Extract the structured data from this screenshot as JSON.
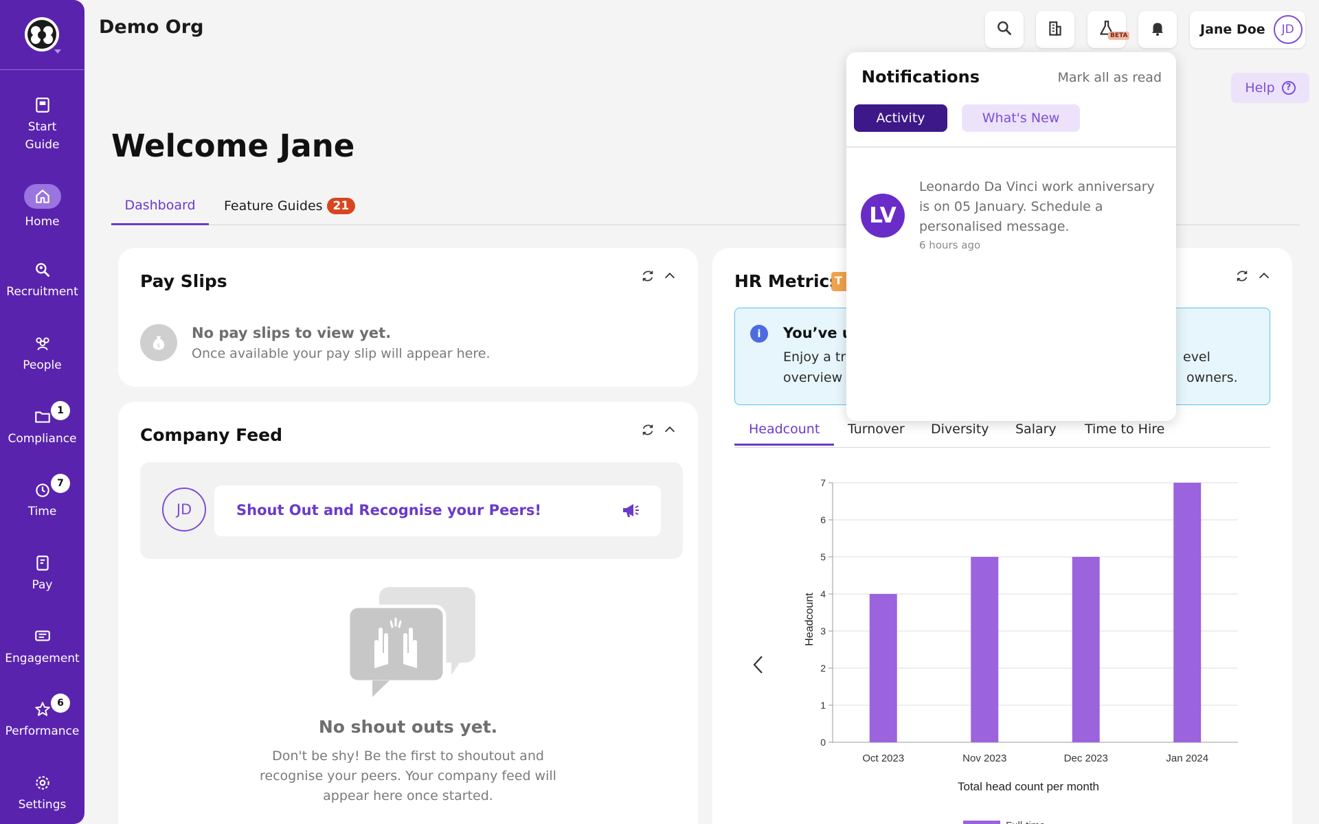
{
  "header": {
    "org_name": "Demo Org",
    "user_name": "Jane Doe",
    "user_initials": "JD",
    "beta_label": "BETA",
    "help_label": "Help"
  },
  "sidebar": {
    "items": [
      {
        "label_line1": "Start",
        "label_line2": "Guide",
        "icon": "book-icon"
      },
      {
        "label": "Home",
        "icon": "home-icon"
      },
      {
        "label": "Recruitment",
        "icon": "search-person-icon"
      },
      {
        "label": "People",
        "icon": "people-icon"
      },
      {
        "label": "Compliance",
        "icon": "folder-icon",
        "badge": "1"
      },
      {
        "label": "Time",
        "icon": "clock-icon",
        "badge": "7"
      },
      {
        "label": "Pay",
        "icon": "payslip-icon"
      },
      {
        "label": "Engagement",
        "icon": "chat-icon"
      },
      {
        "label": "Performance",
        "icon": "star-icon",
        "badge": "6"
      },
      {
        "label": "Settings",
        "icon": "gear-icon"
      }
    ]
  },
  "main": {
    "welcome": "Welcome Jane",
    "tabs": {
      "dashboard": "Dashboard",
      "guides": "Feature Guides",
      "guides_badge": "21"
    }
  },
  "payslips": {
    "title": "Pay Slips",
    "empty_title": "No pay slips to view yet.",
    "empty_text": "Once available your pay slip will appear here."
  },
  "feed": {
    "title": "Company Feed",
    "avatar": "JD",
    "shout_prompt": "Shout Out and Recognise your Peers!",
    "empty_title": "No shout outs yet.",
    "empty_text": "Don't be shy! Be the first to shoutout and recognise your peers. Your company feed will appear here once started."
  },
  "hr_metrics": {
    "title": "HR Metrics",
    "trial_tag": "T",
    "info_title": "You’ve u",
    "info_line1_left": "Enjoy a tri",
    "info_line1_right": "evel",
    "info_line2_left": "overview",
    "info_line2_right": "owners.",
    "tabs": [
      "Headcount",
      "Turnover",
      "Diversity",
      "Salary",
      "Time to Hire"
    ]
  },
  "chart_data": {
    "type": "bar",
    "categories": [
      "Oct 2023",
      "Nov 2023",
      "Dec 2023",
      "Jan 2024"
    ],
    "series": [
      {
        "name": "Full-time",
        "values": [
          4,
          5,
          5,
          7
        ]
      }
    ],
    "xlabel": "Total head count per month",
    "ylabel": "Headcount",
    "ylim": [
      0,
      7
    ],
    "yticks": [
      0,
      1,
      2,
      3,
      4,
      5,
      6,
      7
    ],
    "grid": true,
    "legend": "bottom",
    "color": "#9b63dd"
  },
  "notifications": {
    "title": "Notifications",
    "mark_all": "Mark all as read",
    "tab_activity": "Activity",
    "tab_whats_new": "What's New",
    "items": [
      {
        "initials": "LV",
        "message": "Leonardo Da Vinci work anniversary is on 05 January. Schedule a personalised message.",
        "time": "6 hours ago"
      }
    ]
  },
  "colors": {
    "brand": "#5a23ad",
    "accent": "#6a3ac9",
    "badge": "#d9451f"
  }
}
